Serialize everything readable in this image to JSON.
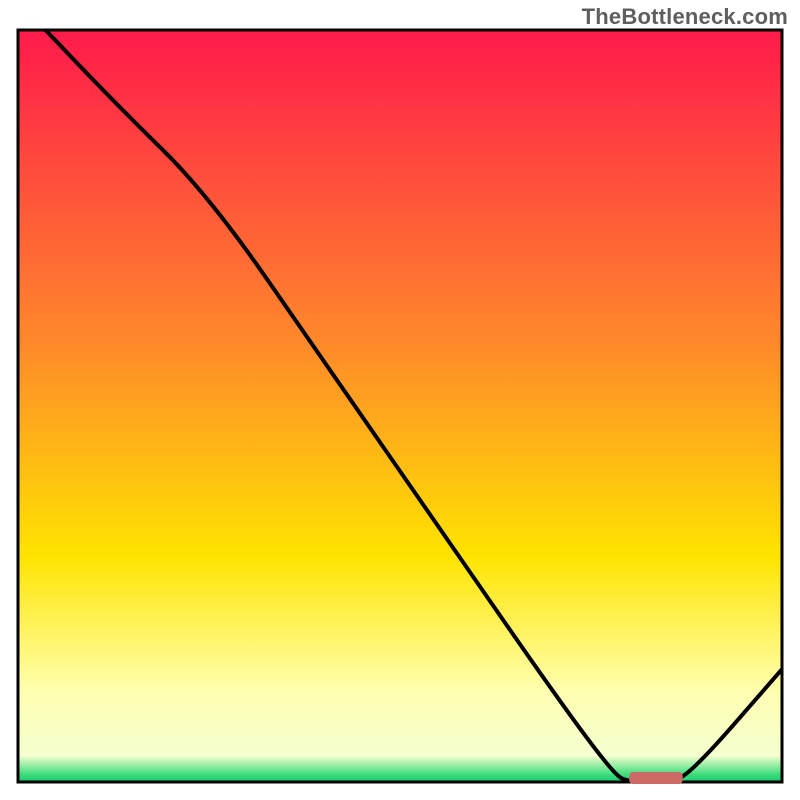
{
  "watermark": {
    "text": "TheBottleneck.com"
  },
  "chart_data": {
    "type": "line",
    "title": "",
    "xlabel": "",
    "ylabel": "",
    "xlim": [
      0,
      100
    ],
    "ylim": [
      0,
      100
    ],
    "series": [
      {
        "name": "bottleneck-curve",
        "x": [
          3.6,
          13,
          25,
          40,
          55,
          70,
          78,
          80,
          85,
          88,
          100
        ],
        "values": [
          100,
          90,
          78,
          56,
          34,
          12,
          1,
          0,
          0,
          1,
          15
        ]
      }
    ],
    "marker": {
      "name": "optimal-range",
      "x_start": 80,
      "x_end": 87,
      "y": 0
    },
    "gradient_bands": [
      {
        "stop": 0.0,
        "color": "#ff1a4b"
      },
      {
        "stop": 0.42,
        "color": "#ff8a2a"
      },
      {
        "stop": 0.7,
        "color": "#ffe400"
      },
      {
        "stop": 0.88,
        "color": "#ffffb0"
      },
      {
        "stop": 0.965,
        "color": "#f5ffd0"
      },
      {
        "stop": 0.99,
        "color": "#3edc7c"
      },
      {
        "stop": 1.0,
        "color": "#17c96a"
      }
    ]
  }
}
